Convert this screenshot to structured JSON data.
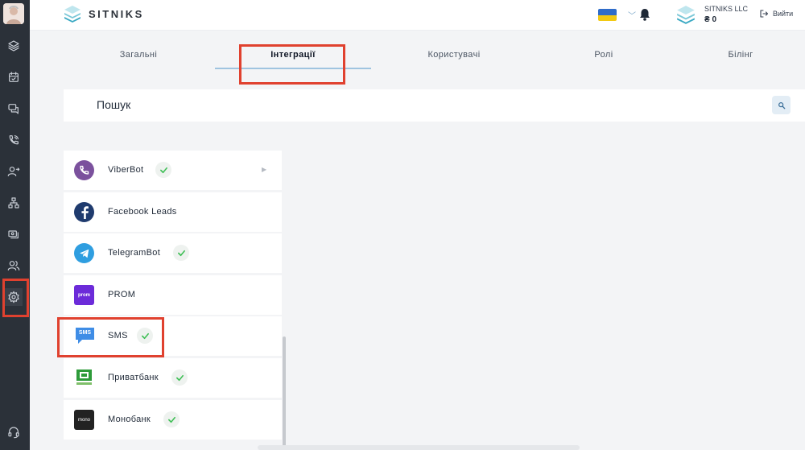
{
  "brand": {
    "name": "SITNIKS"
  },
  "header": {
    "company_name": "SITNIKS LLC",
    "balance": "₴ 0",
    "logout_label": "Вийти"
  },
  "tabs": [
    {
      "label": "Загальні"
    },
    {
      "label": "Інтеграції",
      "active": true
    },
    {
      "label": "Користувачі"
    },
    {
      "label": "Ролі"
    },
    {
      "label": "Білінг"
    }
  ],
  "search": {
    "placeholder": "Пошук"
  },
  "integrations": [
    {
      "label": "ViberBot",
      "icon": "viber-icon",
      "checked": true,
      "arrow": true
    },
    {
      "label": "Facebook Leads",
      "icon": "facebook-icon",
      "checked": false
    },
    {
      "label": "TelegramBot",
      "icon": "telegram-icon",
      "checked": true
    },
    {
      "label": "PROM",
      "icon": "prom-icon",
      "logo_text": "prom",
      "checked": false
    },
    {
      "label": "SMS",
      "icon": "sms-icon",
      "logo_text": "SMS",
      "checked": true
    },
    {
      "label": "Приватбанк",
      "icon": "privatbank-icon",
      "checked": true
    },
    {
      "label": "Монобанк",
      "icon": "monobank-icon",
      "logo_text": "mono",
      "checked": true
    }
  ],
  "colors": {
    "sidebar_bg": "#2b3139",
    "highlight_red": "#e0412f",
    "check_green": "#3fbf56",
    "viber": "#7b519d",
    "facebook": "#1f3b6e",
    "telegram": "#2f9ee0",
    "prom": "#6c2bd9",
    "sms": "#3f8de6",
    "privatbank": "#2e9b3a",
    "monobank": "#222222"
  }
}
